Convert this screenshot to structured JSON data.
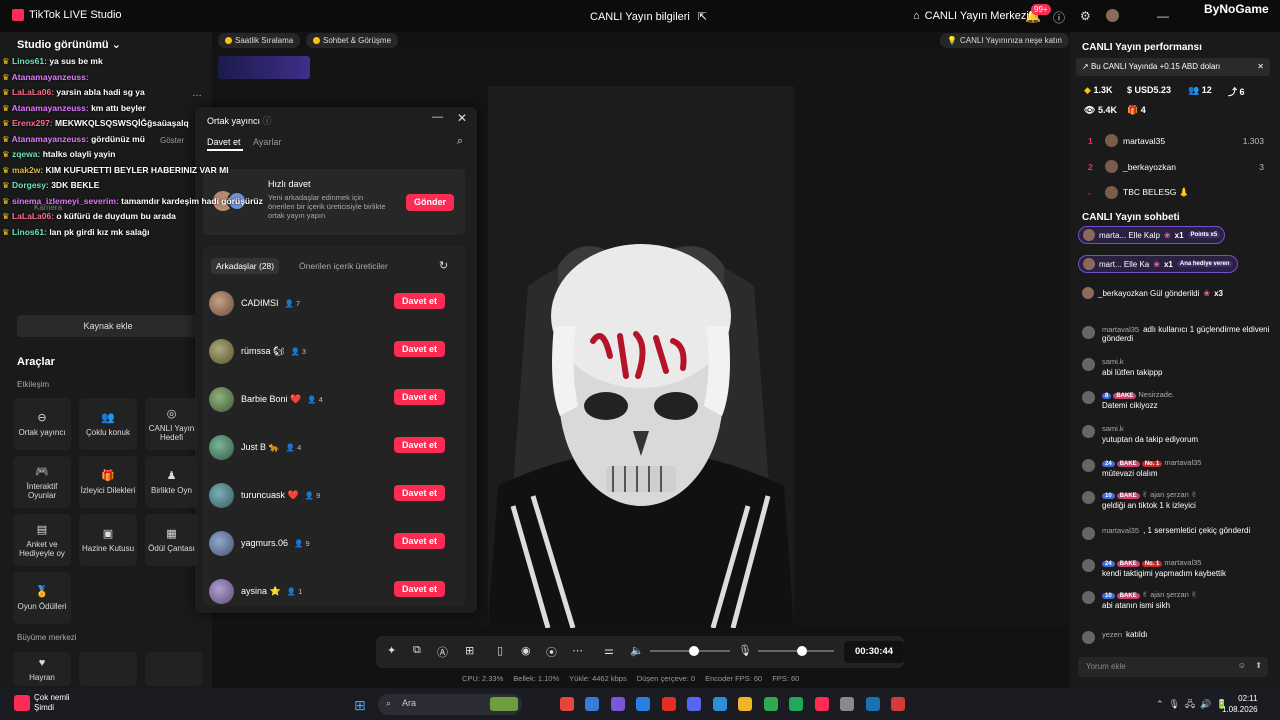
{
  "titlebar": {
    "app_title": "TikTok LIVE Studio",
    "live_info": "CANLI Yayın bilgileri",
    "live_center": "CANLI Yayın Merkezi",
    "notif_count": "99+",
    "watermark": "ByNoGame"
  },
  "left": {
    "studio_view": "Studio görünümü",
    "chat_overlay": [
      {
        "user": "Linos61:",
        "text": "ya sus be mk",
        "cls": "u1"
      },
      {
        "user": "Atanamayanzeuss:",
        "text": "",
        "cls": "u2"
      },
      {
        "user": "LaLaLa06:",
        "text": "yarsin abla hadi sg ya",
        "cls": "u3"
      },
      {
        "user": "Atanamayanzeuss:",
        "text": "km attı beyler",
        "cls": "u2"
      },
      {
        "user": "Erenx297:",
        "text": "MEKWKQLSQSWSQİĞğsaüaşalq",
        "cls": "u3"
      },
      {
        "user": "Atanamayanzeuss:",
        "text": "gördünüz mü",
        "cls": "u2"
      },
      {
        "user": "zqewa:",
        "text": "htalks olayli yayin",
        "cls": "u1"
      },
      {
        "user": "mak2w:",
        "text": "KIM KUFURETTI BEYLER HABERINIZ VAR MI",
        "cls": "u4"
      },
      {
        "user": "Dorgesy:",
        "text": "3DK BEKLE",
        "cls": "u1"
      },
      {
        "user": "sinema_izlemeyi_severim:",
        "text": "tamamdır kardeşim hadi görüşürüz",
        "cls": "u2"
      },
      {
        "user": "LaLaLa06:",
        "text": "o küfürü de duydum bu arada",
        "cls": "u3"
      },
      {
        "user": "Linos61:",
        "text": "lan pk girdi kız mk salağı",
        "cls": "u1"
      }
    ],
    "ghost_labels": {
      "show": "Göster",
      "camera": "Kamera"
    },
    "add_source": "Kaynak ekle",
    "tools_title": "Araçlar",
    "engagement": "Etkileşim",
    "tools": [
      {
        "label": "Ortak yayıncı",
        "icon": "co-host-icon",
        "glyph": "⊖"
      },
      {
        "label": "Çoklu konuk",
        "icon": "multi-guest-icon",
        "glyph": "👥"
      },
      {
        "label": "CANLI Yayın Hedefi",
        "icon": "live-goal-icon",
        "glyph": "◎"
      },
      {
        "label": "İnteraktif Oyunlar",
        "icon": "game-icon",
        "glyph": "🎮"
      },
      {
        "label": "İzleyici Dilekleri",
        "icon": "wish-icon",
        "glyph": "🎁"
      },
      {
        "label": "Birlikte Oyn",
        "icon": "play-together-icon",
        "glyph": "♟"
      },
      {
        "label": "Anket ve Hediyeyle oy",
        "icon": "poll-icon",
        "glyph": "▤"
      },
      {
        "label": "Hazine Kutusu",
        "icon": "treasure-icon",
        "glyph": "▣"
      },
      {
        "label": "Ödül Çantası",
        "icon": "reward-bag-icon",
        "glyph": "▦"
      },
      {
        "label": "Oyun Ödülleri",
        "icon": "game-reward-icon",
        "glyph": "🏅"
      }
    ],
    "growth": "Büyüme merkezi",
    "growth_tools": [
      {
        "label": "Hayran",
        "icon": "fan-icon",
        "glyph": "♥"
      }
    ]
  },
  "topchips": {
    "hourly_rank": "Saatlik Sıralama",
    "chat_meeting": "Sohbet & Görüşme",
    "cheer": "CANLI Yayınınıza neşe katın"
  },
  "modal": {
    "title": "Ortak yayıncı",
    "tab_invite": "Davet et",
    "tab_settings": "Ayarlar",
    "quick_title": "Hızlı davet",
    "quick_desc": "Yeni arkadaşlar edinmek için önerilen bir içerik üreticisiyle birlikte ortak yayın yapın",
    "send": "Gönder",
    "friends_tab": "Arkadaşlar (28)",
    "suggested_tab": "Önerilen içerik üreticiler",
    "friends": [
      {
        "name": "CADIMSI",
        "count": "7"
      },
      {
        "name": "rümssa 🐿",
        "count": "3"
      },
      {
        "name": "Barbie Boni ❤️",
        "count": "4"
      },
      {
        "name": "Just B 🐆",
        "count": "4"
      },
      {
        "name": "turuncuask ❤️",
        "count": "9"
      },
      {
        "name": "yagmurs.06",
        "count": "9"
      },
      {
        "name": "aysina ⭐",
        "count": "1"
      }
    ],
    "invite_label": "Davet et"
  },
  "toolbar": {
    "timer": "00:30:44"
  },
  "stats": {
    "cpu": "CPU: 2.33%",
    "mem": "Bellek: 1.10%",
    "upload": "Yükle: 4462 kbps",
    "dropped": "Düşen çerçeve: 0",
    "encoder": "Encoder FPS: 60",
    "fps": "FPS: 60"
  },
  "right": {
    "perf_title": "CANLI Yayın performansı",
    "perf_banner": "Bu CANLI Yayında +0.15 ABD doları",
    "stats": {
      "likes": "1.3K",
      "usd": "USD5.23",
      "people": "12",
      "shares": "6",
      "viewers": "5.4K",
      "gifts": "4"
    },
    "ranks": [
      {
        "n": "1",
        "name": "martaval35",
        "val": "1.303"
      },
      {
        "n": "2",
        "name": "_berkayozkan",
        "val": "3"
      },
      {
        "n": "-",
        "name": "TBC BELESG 👃",
        "val": ""
      }
    ],
    "chat_title": "CANLI Yayın sohbeti",
    "gifts": [
      {
        "name": "marta... Elle Kalp",
        "mult": "x1",
        "tag": "Points x5"
      },
      {
        "name": "mart... Elle Ka",
        "mult": "x1",
        "tag": "Ana hediye veren"
      },
      {
        "name": "_berkayozkan Gül gönderildi",
        "mult": "x3",
        "tag": ""
      }
    ],
    "messages": [
      {
        "user": "martaval35",
        "text": "adlı kullanıcı 1 güçlendirme eldiveni gönderdi",
        "badges": []
      },
      {
        "user": "sami.k",
        "text": "abi lütfen takippp",
        "badges": []
      },
      {
        "user": "Nesirzade.",
        "text": "Datemi cikiyozz",
        "badges": [
          "8",
          "BAKE"
        ]
      },
      {
        "user": "sami.k",
        "text": "yutuptan da takip ediyorum",
        "badges": []
      },
      {
        "user": "martaval35",
        "text": "mütevazi olalım",
        "badges": [
          "24",
          "BAKE",
          "No. 1"
        ]
      },
      {
        "user": "✌ ajan şerzan ✌",
        "text": "geldiği an tiktok 1 k izleyici",
        "badges": [
          "10",
          "BAKE"
        ]
      },
      {
        "user": "martaval35",
        "text": ", 1 sersemletici çekiç gönderdi",
        "badges": []
      },
      {
        "user": "martaval35",
        "text": "kendi taktigimi yapmadım kaybettik",
        "badges": [
          "24",
          "BAKE",
          "No. 1"
        ]
      },
      {
        "user": "✌ ajan şerzan ✌",
        "text": "abi atanın ismi sikh",
        "badges": [
          "10",
          "BAKE"
        ]
      },
      {
        "user": "yezen",
        "text": "katıldı",
        "badges": []
      }
    ],
    "comment_placeholder": "Yorum ekle"
  },
  "taskbar": {
    "notif_title": "Çok nemli",
    "notif_sub": "Şimdi",
    "search": "Ara",
    "time": "02:11",
    "date": "1.08.2026"
  }
}
